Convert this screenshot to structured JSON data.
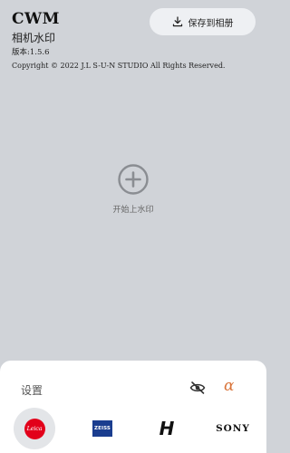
{
  "header": {
    "title": "CWM",
    "subtitle": "相机水印",
    "version": "版本:1.5.6",
    "copyright": "Copyright © 2022 J.L S-U-N STUDIO All Rights Reserved."
  },
  "toolbar": {
    "save_label": "保存到相册",
    "save_icon": "download-icon"
  },
  "canvas": {
    "start_label": "开始上水印",
    "start_icon": "plus-circle-icon"
  },
  "settings": {
    "label": "设置",
    "visibility_icon": "eye-off-icon",
    "sony_alpha_icon": "α"
  },
  "brands": {
    "leica": "Leica",
    "zeiss": "ZEISS",
    "hasselblad": "H",
    "sony": "SONY",
    "colors": {
      "leica_red": "#e2001a",
      "zeiss_blue": "#1a3d8f",
      "alpha_orange": "#d9743a"
    }
  }
}
